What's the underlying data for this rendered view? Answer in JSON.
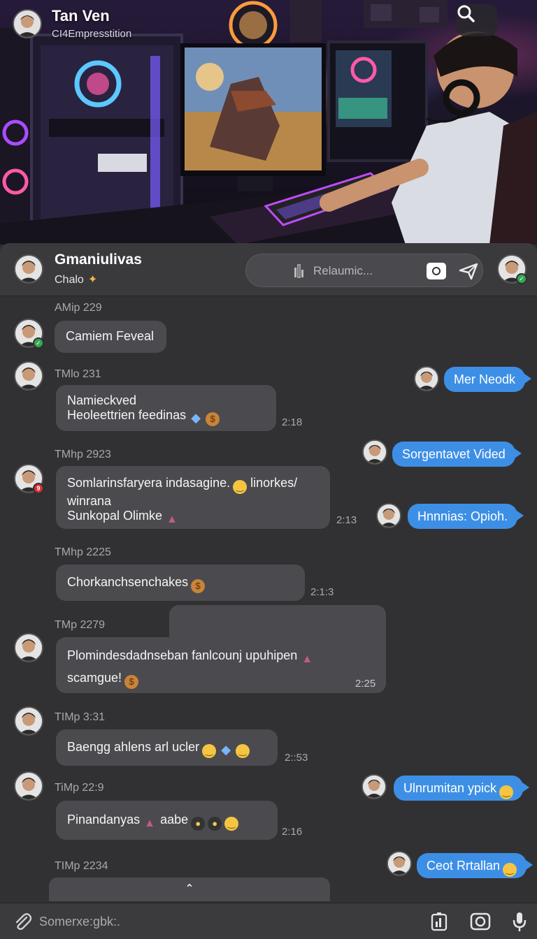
{
  "hero": {
    "name": "Tan Ven",
    "subtitle": "CI4Empresstition"
  },
  "chat": {
    "title": "Gmaniulivas",
    "status": "Chalo",
    "search_placeholder": "Relaumic...",
    "messages_in": [
      {
        "label": "AMip 229",
        "text": "Camiem Feveal",
        "time": ""
      },
      {
        "label": "TMlo 231",
        "line1": "Namieckved",
        "line2": "Heoleettrien feedinas",
        "time": "2:18"
      },
      {
        "label": "TMhp 2923",
        "line1": "Somlarinsfaryera indasagine.",
        "line1b": "linorkes/",
        "line2": "winrana",
        "line3": "Sunkopal Olimke",
        "time": "2:13"
      },
      {
        "label": "TMhp 2225",
        "text": "Chorkanchsenchakes",
        "time": "2:1:3"
      },
      {
        "label": "TMp 2279",
        "line1": "Plomindesdadnseban fanlcounj upuhipen",
        "line2": "scamgue!",
        "time": "2:25"
      },
      {
        "label": "TIMp 3:31",
        "text": "Baengg ahlens arl ucler",
        "time": "2::53"
      },
      {
        "label": "TiMp 22:9",
        "text": "Pinandanyas",
        "text_b": "aabe",
        "time": "2:16"
      },
      {
        "label": "TIMp 2234",
        "text": "",
        "time": ""
      }
    ],
    "messages_out": [
      {
        "text": "Mer Neodk"
      },
      {
        "text": "Sorgentavet Vided"
      },
      {
        "text": "Hnnnias: Opioh."
      },
      {
        "text": "Ulnrumitan ypick"
      },
      {
        "text": "Ceot Rrtallan"
      }
    ],
    "scroll_glyph": "⌃"
  },
  "composer": {
    "placeholder": "Somerxe:gbk:."
  },
  "colors": {
    "outgoing": "#3d8fe6",
    "incoming": "#4b4b4f",
    "panel": "#313133",
    "status_green": "#34a853",
    "status_red": "#d93030"
  },
  "icons": [
    "search-icon",
    "attach-icon",
    "camera-icon",
    "send-icon",
    "mic-icon",
    "chart-icon",
    "sparkle-icon"
  ]
}
